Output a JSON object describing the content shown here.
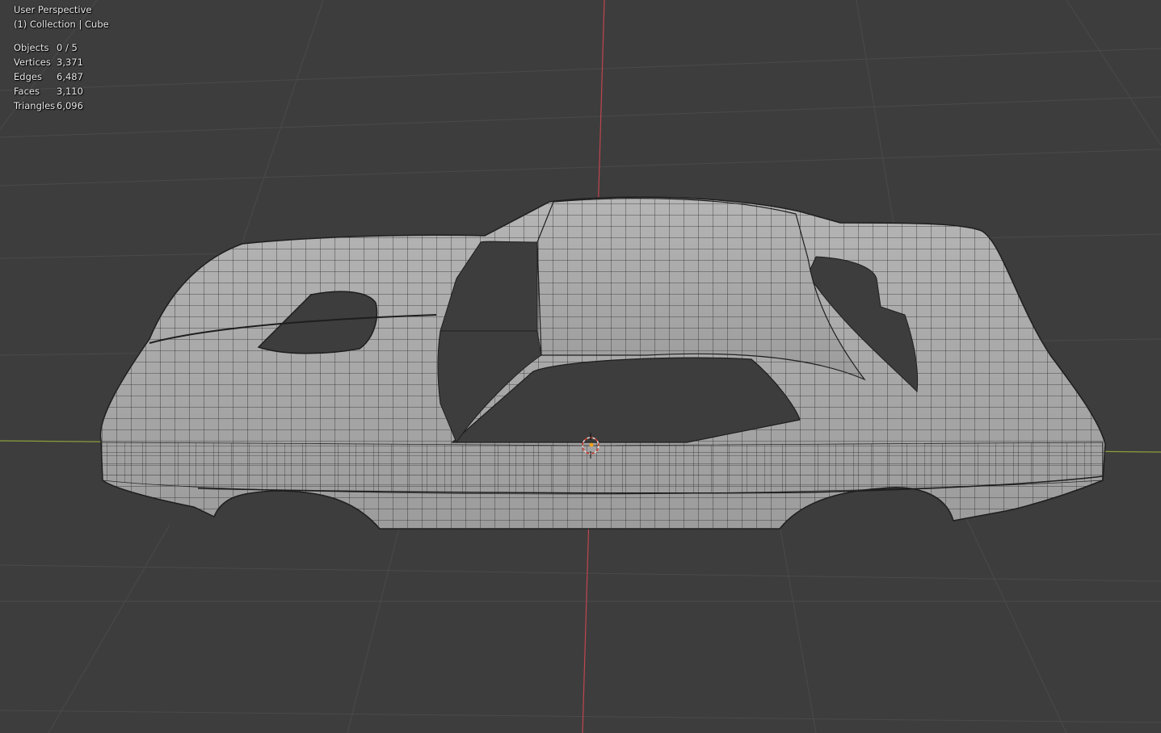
{
  "viewport": {
    "view_name": "User Perspective",
    "collection_line": "(1) Collection | Cube",
    "stats": [
      {
        "label": "Objects",
        "value": "0 / 5"
      },
      {
        "label": "Vertices",
        "value": "3,371"
      },
      {
        "label": "Edges",
        "value": "6,487"
      },
      {
        "label": "Faces",
        "value": "3,110"
      },
      {
        "label": "Triangles",
        "value": "6,096"
      }
    ]
  },
  "colors": {
    "background": "#3d3d3d",
    "grid": "#4a4a4a",
    "x_axis": "#8b9f3c",
    "y_axis": "#c0454f",
    "mesh_face": "#a9a9a9",
    "mesh_wire": "#202020",
    "cursor": "#e0703a"
  },
  "icons": [
    "3d-cursor-icon",
    "origin-dot-icon"
  ]
}
